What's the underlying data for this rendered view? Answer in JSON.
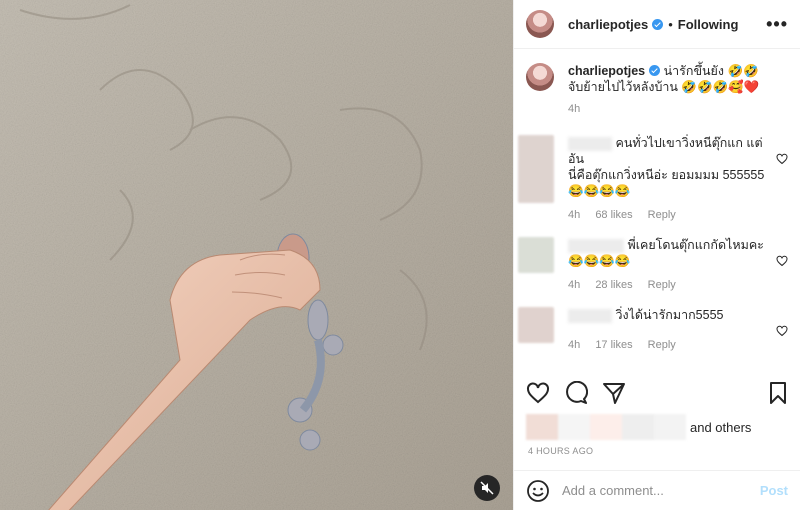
{
  "post": {
    "username": "charliepotjes",
    "follow_status": "Following",
    "separator": "•",
    "more": "•••",
    "caption_line1": "น่ารักขึ้นยัง 🤣🤣",
    "caption_line2": "จับย้ายไปไว้หลังบ้าน 🤣🤣🤣🥰❤️",
    "caption_age": "4h"
  },
  "comments": [
    {
      "text_line1": "คนทั่วไปเขาวิ่งหนีตุ๊กแก แต่อัน",
      "text_line2": "นี่คือตุ๊กแกวิ่งหนีอ่ะ ยอมมมม 555555",
      "text_line3": "😂😂😂😂",
      "age": "4h",
      "likes": "68 likes",
      "reply": "Reply"
    },
    {
      "text_line1": "พี่เคยโดนตุ๊กแกกัดไหมคะ",
      "text_line2": "😂😂😂😂",
      "text_line3": "",
      "age": "4h",
      "likes": "28 likes",
      "reply": "Reply"
    },
    {
      "text_line1": "วิ่งได้น่ารักมาก5555",
      "text_line2": "",
      "text_line3": "",
      "age": "4h",
      "likes": "17 likes",
      "reply": "Reply"
    }
  ],
  "likes_text": "and others",
  "timestamp": "4 HOURS AGO",
  "comment_input": {
    "placeholder": "Add a comment...",
    "post_label": "Post"
  },
  "colors": {
    "verified": "#3897f0",
    "post_button": "#b2dffc",
    "muted_text": "#8e8e8e"
  }
}
